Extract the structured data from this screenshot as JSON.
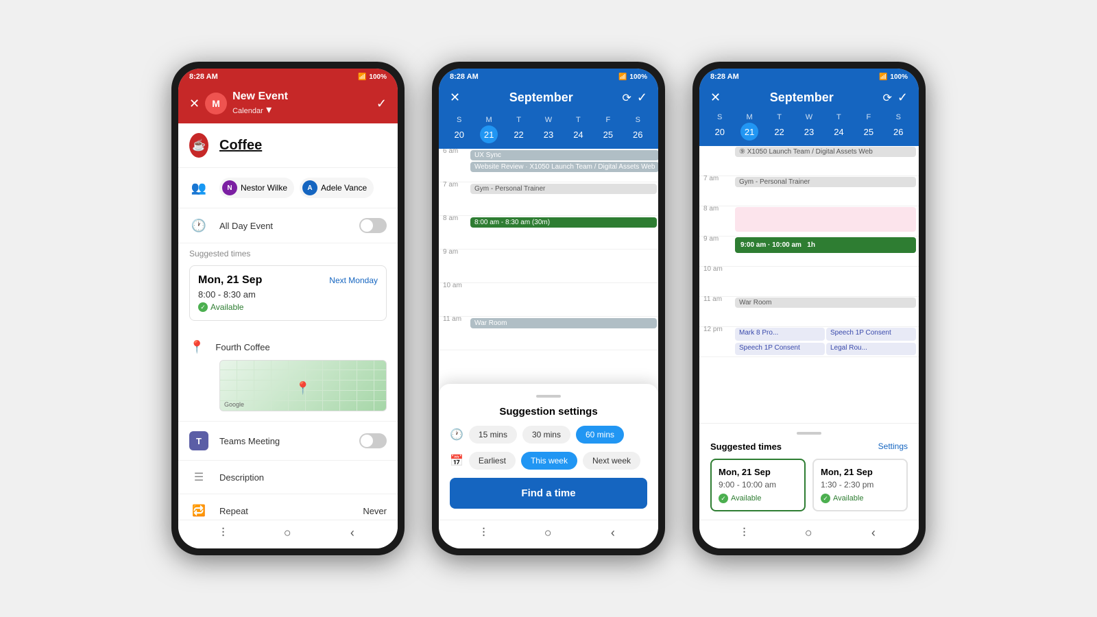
{
  "phone1": {
    "status_bar": {
      "time": "8:28 AM",
      "battery": "100%"
    },
    "header": {
      "title": "New Event",
      "subtitle": "Calendar",
      "avatar": "M",
      "close_icon": "✕",
      "check_icon": "✓"
    },
    "event_name": "Coffee",
    "attendees": [
      {
        "name": "Nestor Wilke",
        "initials": "N",
        "color": "#7b1fa2"
      },
      {
        "name": "Adele Vance",
        "initials": "A",
        "color": "#1565c0"
      }
    ],
    "all_day_label": "All Day Event",
    "suggested_times_label": "Suggested times",
    "suggestion": {
      "date": "Mon, 21 Sep",
      "next_label": "Next Monday",
      "time": "8:00 - 8:30 am",
      "available": "Available"
    },
    "location": "Fourth Coffee",
    "teams_label": "Teams Meeting",
    "description_label": "Description",
    "repeat_label": "Repeat",
    "repeat_value": "Never",
    "map_label": "Google"
  },
  "phone2": {
    "status_bar": {
      "time": "8:28 AM",
      "battery": "100%"
    },
    "header": {
      "title": "September",
      "close_icon": "✕",
      "check_icon": "✓"
    },
    "calendar": {
      "days": [
        "S",
        "M",
        "T",
        "W",
        "T",
        "F",
        "S"
      ],
      "dates": [
        "20",
        "21",
        "22",
        "23",
        "24",
        "25",
        "26"
      ],
      "today_index": 1
    },
    "time_slots": [
      {
        "time": "6 am",
        "events": [
          {
            "label": "UX Sync",
            "type": "gray"
          },
          {
            "label": "Website Review · X1050 Launch Team / Digital Assets Web",
            "type": "gray"
          }
        ]
      },
      {
        "time": "7 am",
        "events": [
          {
            "label": "Gym - Personal Trainer",
            "type": "light-gray"
          }
        ]
      },
      {
        "time": "8 am",
        "events": [
          {
            "label": "8:00 am - 8:30 am (30m)",
            "type": "green"
          }
        ]
      },
      {
        "time": "9 am",
        "events": []
      },
      {
        "time": "10 am",
        "events": []
      },
      {
        "time": "11 am",
        "events": [
          {
            "label": "War Room",
            "type": "gray"
          }
        ]
      }
    ],
    "sheet": {
      "title": "Suggestion settings",
      "duration_label": "Duration",
      "chips_duration": [
        "15 mins",
        "30 mins",
        "60 mins"
      ],
      "active_duration_index": 2,
      "date_range_label": "Date range",
      "chips_range": [
        "Earliest",
        "This week",
        "Next week"
      ],
      "active_range_index": 1,
      "button_label": "Find a time"
    }
  },
  "phone3": {
    "status_bar": {
      "time": "8:28 AM",
      "battery": "100%"
    },
    "header": {
      "title": "September",
      "close_icon": "✕",
      "check_icon": "✓"
    },
    "calendar": {
      "days": [
        "S",
        "M",
        "T",
        "W",
        "T",
        "F",
        "S"
      ],
      "dates": [
        "20",
        "21",
        "22",
        "23",
        "24",
        "25",
        "26"
      ],
      "today_index": 1
    },
    "time_slots": [
      {
        "time": "",
        "events": [
          {
            "label": "X1050 Launch Team / Digital Assets Web",
            "type": "light-gray"
          }
        ]
      },
      {
        "time": "7 am",
        "events": [
          {
            "label": "Gym - Personal Trainer",
            "type": "light-gray"
          }
        ]
      },
      {
        "time": "8 am",
        "events": []
      },
      {
        "time": "9 am",
        "events": [
          {
            "label": "9:00 am · 10:00 am  1h",
            "type": "green-bold"
          }
        ]
      },
      {
        "time": "10 am",
        "events": []
      },
      {
        "time": "11 am",
        "events": [
          {
            "label": "War Room",
            "type": "light-gray"
          }
        ]
      },
      {
        "time": "12 pm",
        "events": [
          {
            "label": "Mark 8 Pro...",
            "type": "purple"
          },
          {
            "label": "Speech 1P Consent",
            "type": "purple"
          },
          {
            "label": "Speech 1P Consent",
            "type": "purple"
          },
          {
            "label": "Legal Rou...",
            "type": "purple"
          }
        ]
      }
    ],
    "suggested_times": {
      "title": "Suggested times",
      "settings_label": "Settings",
      "cards": [
        {
          "date": "Mon, 21 Sep",
          "time": "9:00 - 10:00 am",
          "available": "Available",
          "selected": true
        },
        {
          "date": "Mon, 21 Sep",
          "time": "1:30 - 2:30 pm",
          "available": "Available",
          "selected": false
        }
      ]
    }
  },
  "icons": {
    "close": "✕",
    "check": "✓",
    "coffee": "☕",
    "location": "📍",
    "people": "👥",
    "clock": "🕐",
    "repeat": "🔁",
    "description": "☰",
    "teams": "T",
    "note": "📝",
    "calendar": "📅"
  }
}
